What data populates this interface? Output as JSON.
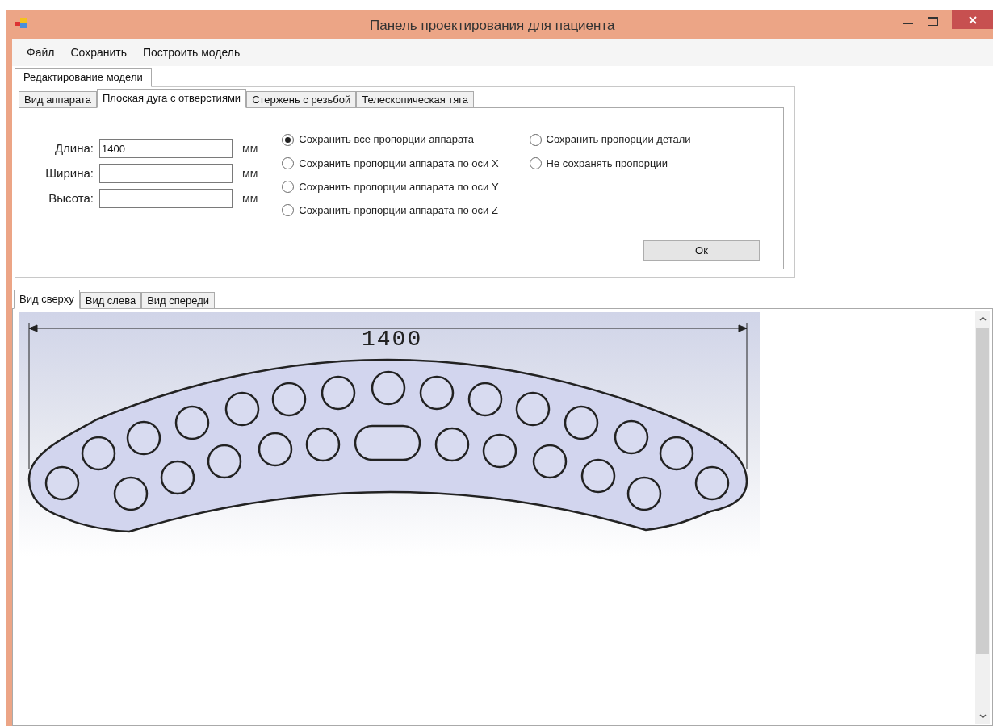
{
  "window": {
    "title": "Панель проектирования для пациента"
  },
  "menu": [
    "Файл",
    "Сохранить",
    "Построить модель"
  ],
  "outer_tabs": [
    {
      "label": "Редактирование модели",
      "selected": true
    }
  ],
  "inner_tabs": [
    {
      "label": "Вид аппарата",
      "selected": false
    },
    {
      "label": "Плоская дуга с отверстиями",
      "selected": true
    },
    {
      "label": "Стержень с резьбой",
      "selected": false
    },
    {
      "label": "Телескопическая тяга",
      "selected": false
    }
  ],
  "fields": [
    {
      "label": "Длина:",
      "value": "1400",
      "unit": "мм"
    },
    {
      "label": "Ширина:",
      "unit": "мм"
    },
    {
      "label": "Высота:",
      "unit": "мм"
    }
  ],
  "radio_options": [
    {
      "label": "Сохранить все пропорции аппарата",
      "selected": true
    },
    {
      "label": "Сохранить пропорции аппарата по оси X",
      "selected": false
    },
    {
      "label": "Сохранить пропорции аппарата по оси Y",
      "selected": false
    },
    {
      "label": "Сохранить пропорции аппарата по оси Z",
      "selected": false
    },
    {
      "label": "Сохранить пропорции детали",
      "selected": false
    },
    {
      "label": "Не сохранять пропорции",
      "selected": false
    }
  ],
  "ok_button": "Ок",
  "view_tabs": [
    {
      "label": "Вид сверху",
      "selected": true
    },
    {
      "label": "Вид слева",
      "selected": false
    },
    {
      "label": "Вид спереди",
      "selected": false
    }
  ],
  "drawing": {
    "dimension": "1400"
  }
}
